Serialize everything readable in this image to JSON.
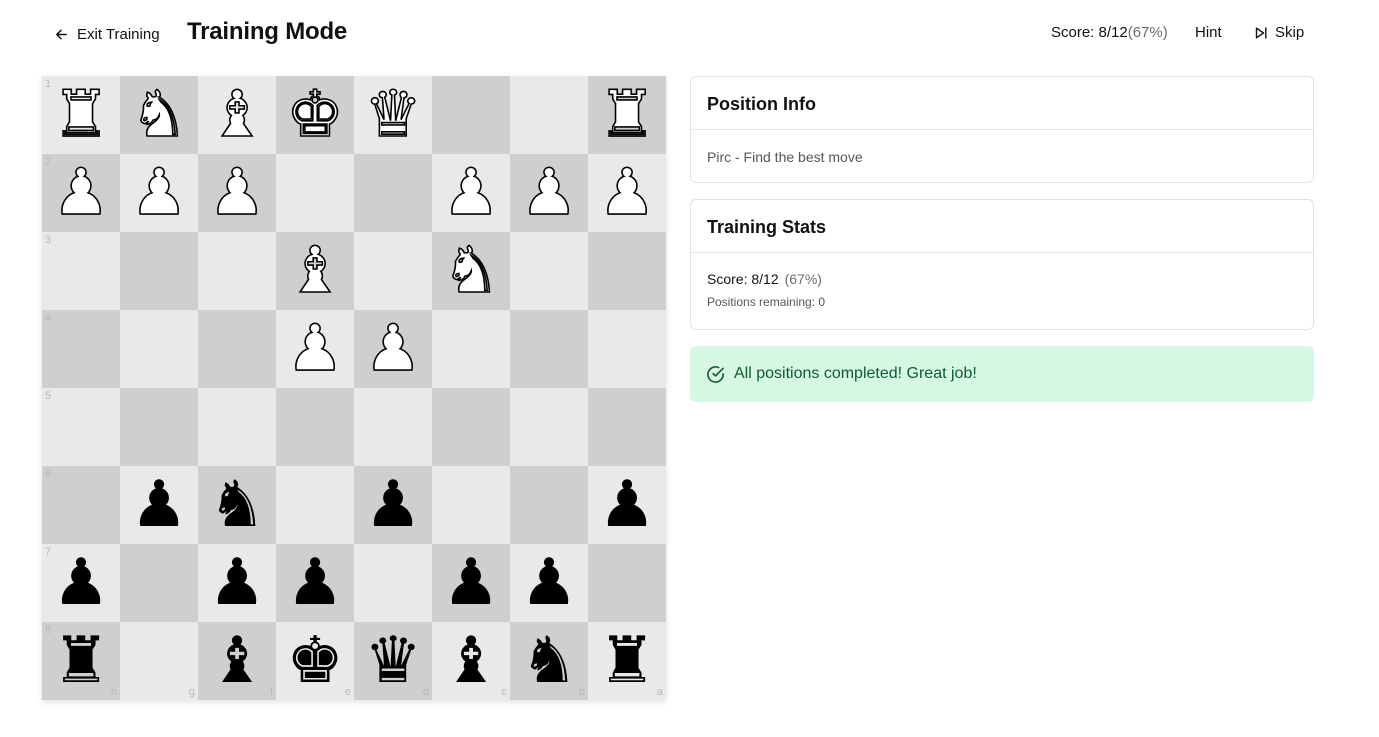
{
  "header": {
    "exit_label": "Exit Training",
    "title": "Training Mode",
    "score_label": "Score: 8/12",
    "score_pct": "(67%)",
    "hint_label": "Hint",
    "skip_label": "Skip"
  },
  "board": {
    "light_color": "#e9e9e9",
    "dark_color": "#cfcfcf",
    "rank_labels": [
      "1",
      "2",
      "3",
      "4",
      "5",
      "6",
      "7",
      "8"
    ],
    "file_labels": [
      "h",
      "g",
      "f",
      "e",
      "d",
      "c",
      "b",
      "a"
    ],
    "rows": [
      [
        "wR",
        "wN",
        "wB",
        "wK",
        "wQ",
        "",
        "",
        "wR"
      ],
      [
        "wP",
        "wP",
        "wP",
        "",
        "",
        "wP",
        "wP",
        "wP"
      ],
      [
        "",
        "",
        "",
        "wB",
        "",
        "wN",
        "",
        ""
      ],
      [
        "",
        "",
        "",
        "wP",
        "wP",
        "",
        "",
        ""
      ],
      [
        "",
        "",
        "",
        "",
        "",
        "",
        "",
        ""
      ],
      [
        "",
        "bP",
        "bN",
        "",
        "bP",
        "",
        "",
        "bP"
      ],
      [
        "bP",
        "",
        "bP",
        "bP",
        "",
        "bP",
        "bP",
        ""
      ],
      [
        "bR",
        "",
        "bB",
        "bK",
        "bQ",
        "bB",
        "bN",
        "bR"
      ]
    ]
  },
  "position_info": {
    "title": "Position Info",
    "description": "Pirc - Find the best move"
  },
  "training_stats": {
    "title": "Training Stats",
    "score_label": "Score: 8/12",
    "score_pct": "(67%)",
    "remaining_label": "Positions remaining: 0"
  },
  "completion": {
    "message": "All positions completed! Great job!",
    "icon": "check-circle-icon",
    "bg_color": "#d6f8e3",
    "text_color": "#0f5a2f"
  }
}
